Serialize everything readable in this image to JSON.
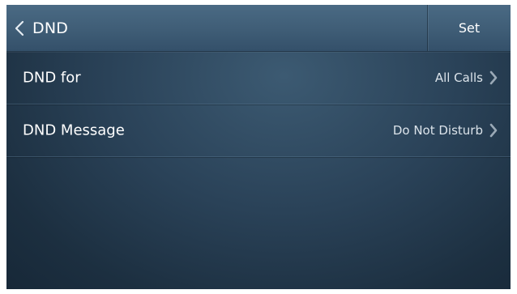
{
  "header": {
    "title": "DND",
    "set_label": "Set"
  },
  "rows": [
    {
      "label": "DND for",
      "value": "All Calls"
    },
    {
      "label": "DND Message",
      "value": "Do Not Disturb"
    }
  ],
  "icons": {
    "back": "chevron-left-icon",
    "row_arrow": "chevron-right-icon"
  },
  "colors": {
    "header_bg": "#3f5d76",
    "screen_bg": "#24394d",
    "text": "#ffffff",
    "chevron": "#9aa9b6"
  }
}
